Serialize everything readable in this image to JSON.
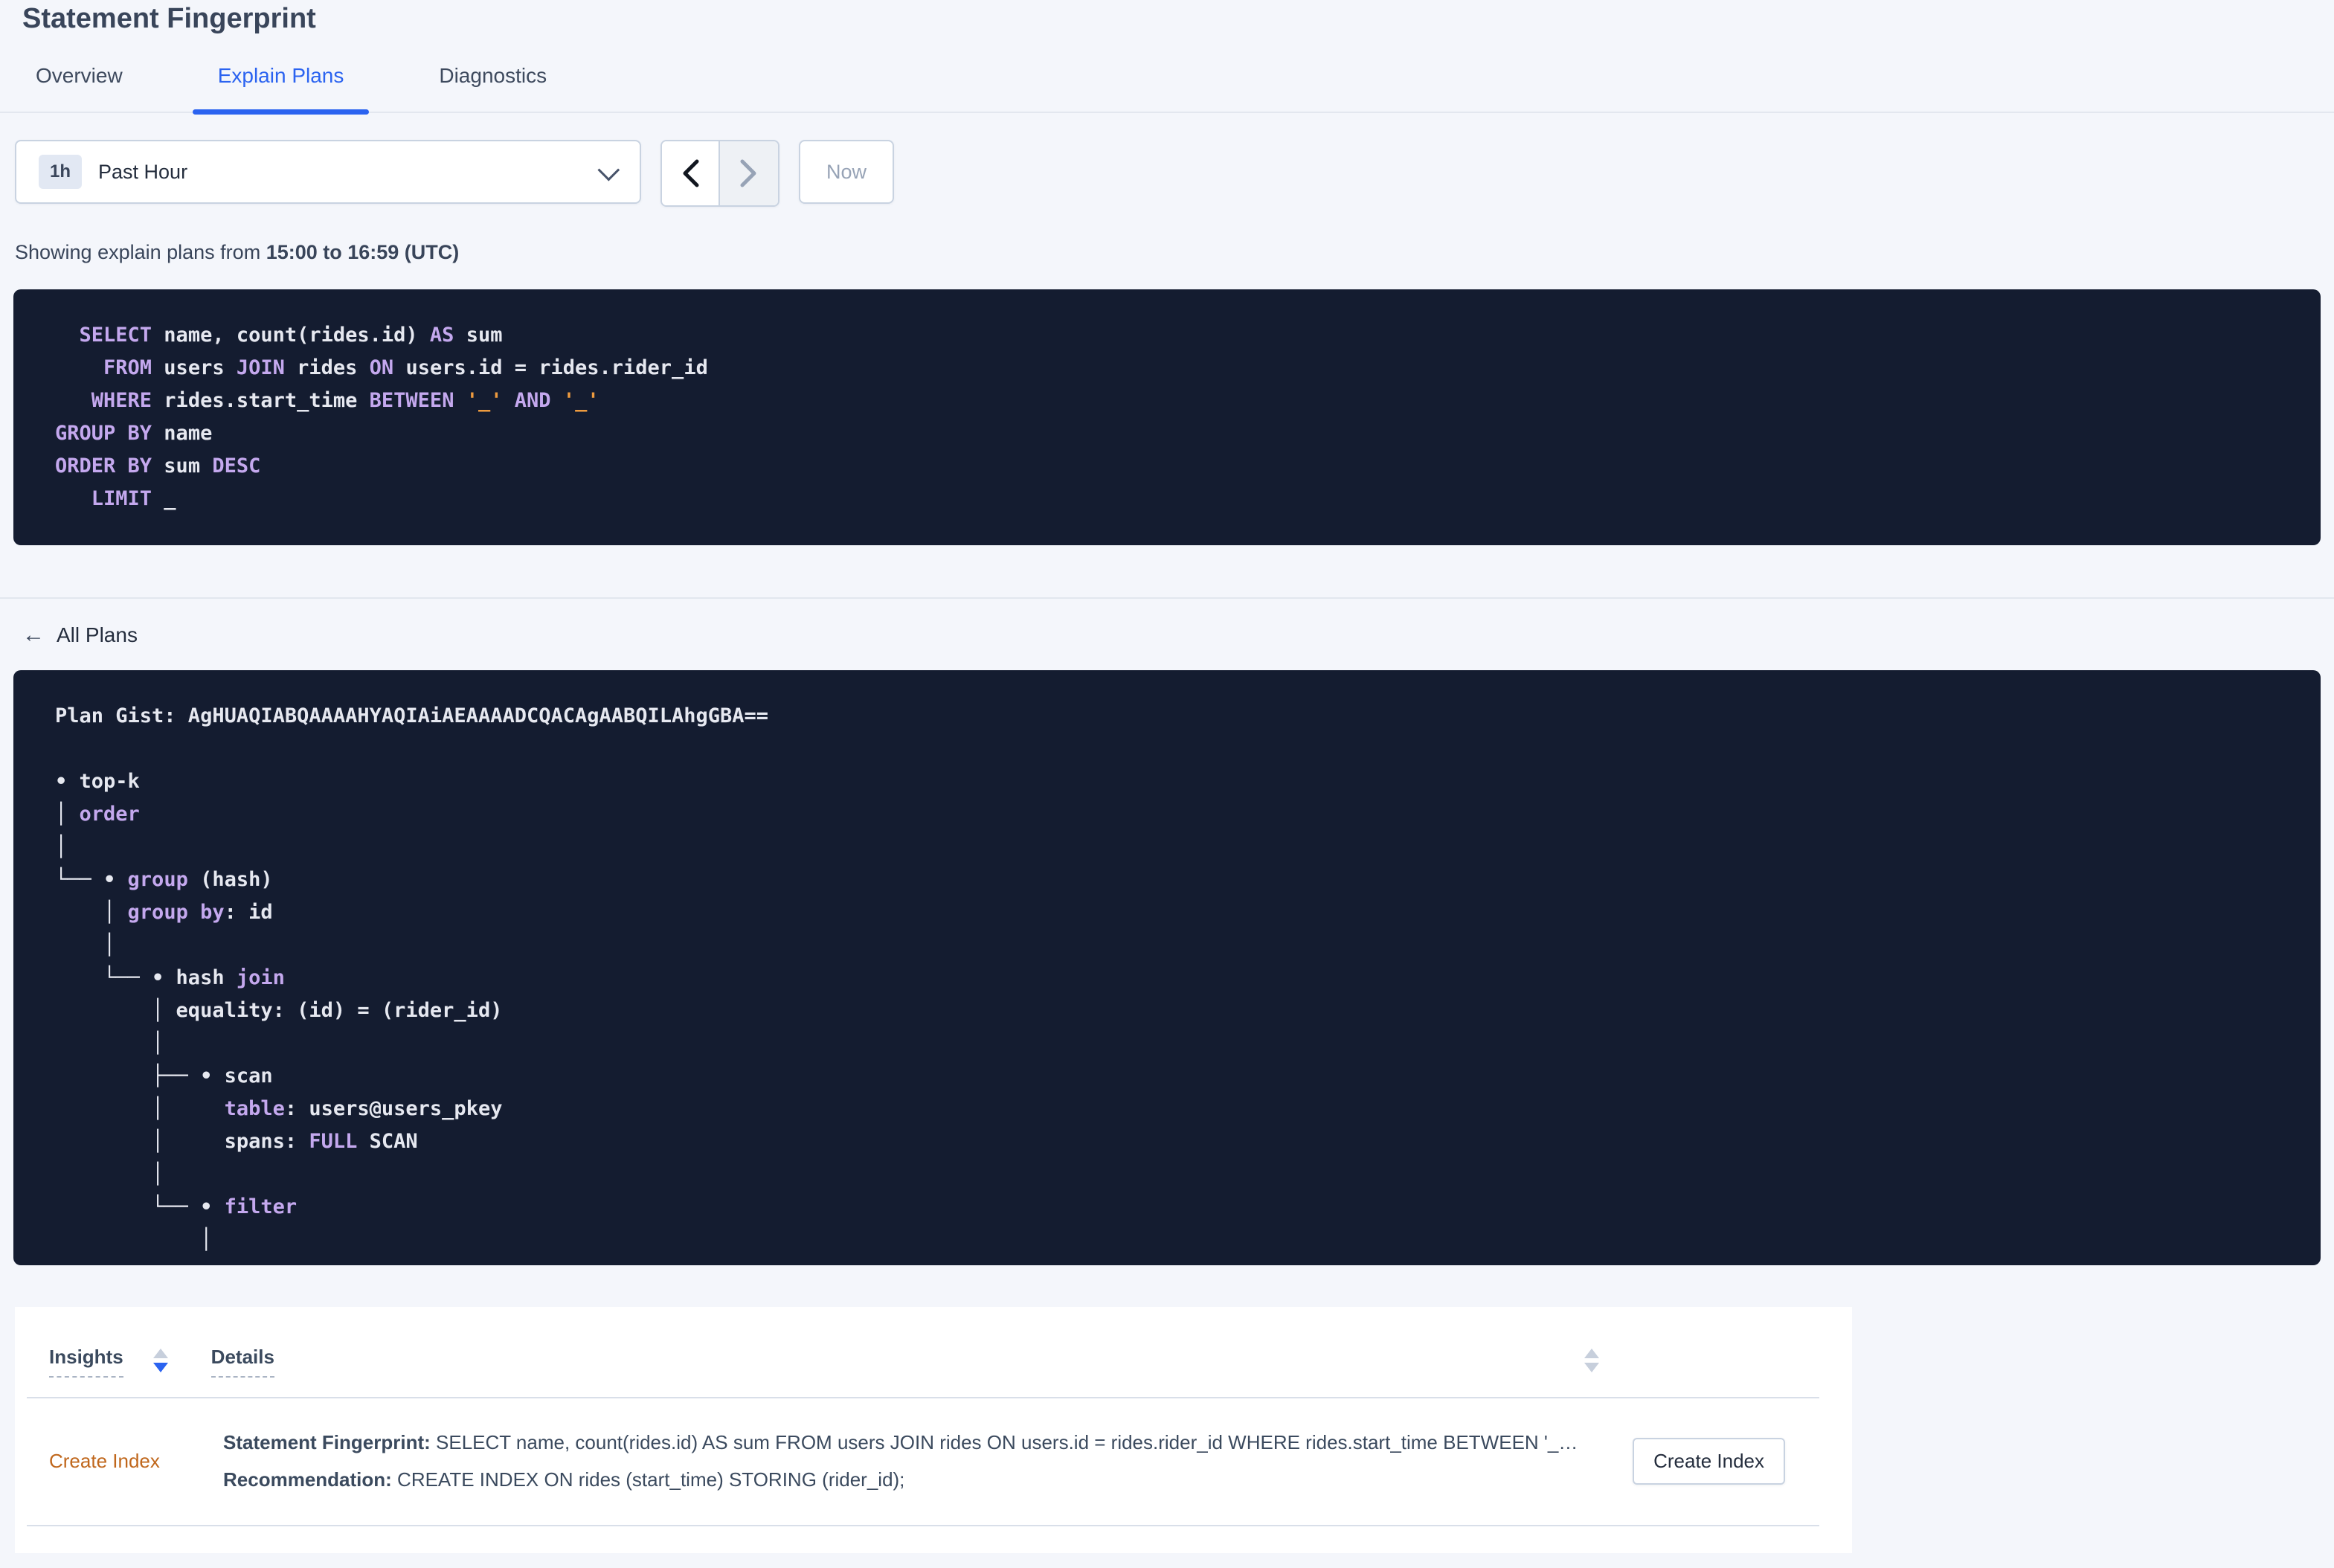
{
  "page": {
    "title": "Statement Fingerprint"
  },
  "tabs": [
    {
      "label": "Overview",
      "active": false
    },
    {
      "label": "Explain Plans",
      "active": true
    },
    {
      "label": "Diagnostics",
      "active": false
    }
  ],
  "time_picker": {
    "badge": "1h",
    "selected": "Past Hour",
    "now_label": "Now",
    "icons": {
      "dropdown": "chevron-down",
      "previous": "chevron-left",
      "next": "chevron-right"
    }
  },
  "caption": {
    "prefix": "Showing explain plans from ",
    "range": "15:00 to 16:59 (UTC)"
  },
  "sql": {
    "lines": [
      [
        {
          "c": "k",
          "s": "  SELECT"
        },
        {
          "c": "t",
          "s": " name, count(rides.id) "
        },
        {
          "c": "k",
          "s": "AS"
        },
        {
          "c": "t",
          "s": " sum"
        }
      ],
      [
        {
          "c": "k",
          "s": "    FROM"
        },
        {
          "c": "t",
          "s": " users "
        },
        {
          "c": "k",
          "s": "JOIN"
        },
        {
          "c": "t",
          "s": " rides "
        },
        {
          "c": "k",
          "s": "ON"
        },
        {
          "c": "t",
          "s": " users.id = rides.rider_id"
        }
      ],
      [
        {
          "c": "k",
          "s": "   WHERE"
        },
        {
          "c": "t",
          "s": " rides.start_time "
        },
        {
          "c": "k",
          "s": "BETWEEN"
        },
        {
          "c": "t",
          "s": " "
        },
        {
          "c": "o",
          "s": "'_'"
        },
        {
          "c": "t",
          "s": " "
        },
        {
          "c": "k",
          "s": "AND"
        },
        {
          "c": "t",
          "s": " "
        },
        {
          "c": "o",
          "s": "'_'"
        }
      ],
      [
        {
          "c": "k",
          "s": "GROUP BY"
        },
        {
          "c": "t",
          "s": " name"
        }
      ],
      [
        {
          "c": "k",
          "s": "ORDER BY"
        },
        {
          "c": "t",
          "s": " sum "
        },
        {
          "c": "k",
          "s": "DESC"
        }
      ],
      [
        {
          "c": "k",
          "s": "   LIMIT"
        },
        {
          "c": "t",
          "s": " _"
        }
      ]
    ]
  },
  "all_plans": {
    "label": "All Plans",
    "icon": "arrow-left",
    "arrow": "←"
  },
  "plan": {
    "lines": [
      [
        {
          "c": "t",
          "s": "Plan Gist: AgHUAQIABQAAAAHYAQIAiAEAAAADCQACAgAABQILAhgGBA=="
        }
      ],
      [],
      [
        {
          "c": "t",
          "s": "• top-k"
        }
      ],
      [
        {
          "c": "t",
          "s": "│ "
        },
        {
          "c": "k",
          "s": "order"
        }
      ],
      [
        {
          "c": "t",
          "s": "│"
        }
      ],
      [
        {
          "c": "t",
          "s": "└── • "
        },
        {
          "c": "k",
          "s": "group"
        },
        {
          "c": "t",
          "s": " (hash)"
        }
      ],
      [
        {
          "c": "t",
          "s": "    │ "
        },
        {
          "c": "k",
          "s": "group by"
        },
        {
          "c": "t",
          "s": ": id"
        }
      ],
      [
        {
          "c": "t",
          "s": "    │"
        }
      ],
      [
        {
          "c": "t",
          "s": "    └── • hash "
        },
        {
          "c": "k",
          "s": "join"
        }
      ],
      [
        {
          "c": "t",
          "s": "        │ equality: (id) = (rider_id)"
        }
      ],
      [
        {
          "c": "t",
          "s": "        │"
        }
      ],
      [
        {
          "c": "t",
          "s": "        ├── • scan"
        }
      ],
      [
        {
          "c": "t",
          "s": "        │     "
        },
        {
          "c": "k",
          "s": "table"
        },
        {
          "c": "t",
          "s": ": users@users_pkey"
        }
      ],
      [
        {
          "c": "t",
          "s": "        │     spans: "
        },
        {
          "c": "k",
          "s": "FULL"
        },
        {
          "c": "t",
          "s": " SCAN"
        }
      ],
      [
        {
          "c": "t",
          "s": "        │"
        }
      ],
      [
        {
          "c": "t",
          "s": "        └── • "
        },
        {
          "c": "k",
          "s": "filter"
        }
      ],
      [
        {
          "c": "t",
          "s": "            │"
        }
      ]
    ]
  },
  "insights_table": {
    "columns": [
      {
        "label": "Insights",
        "sort": "desc"
      },
      {
        "label": "Details",
        "sort": "none"
      }
    ],
    "rows": [
      {
        "insight": "Create Index",
        "detail_label_1": "Statement Fingerprint:",
        "detail_text_1": " SELECT name, count(rides.id) AS sum FROM users JOIN rides ON users.id = rides.rider_id WHERE rides.start_time BETWEEN '_…",
        "detail_label_2": "Recommendation:",
        "detail_text_2": " CREATE INDEX ON rides (start_time) STORING (rider_id);",
        "action_label": "Create Index"
      }
    ]
  },
  "colors": {
    "accent_blue": "#2b63f0",
    "panel_bg": "#141c30",
    "keyword_lavender": "#c4a8ee",
    "literal_orange": "#ee9b3f",
    "insight_link_orange": "#c0671c",
    "page_bg": "#f4f6fb"
  }
}
